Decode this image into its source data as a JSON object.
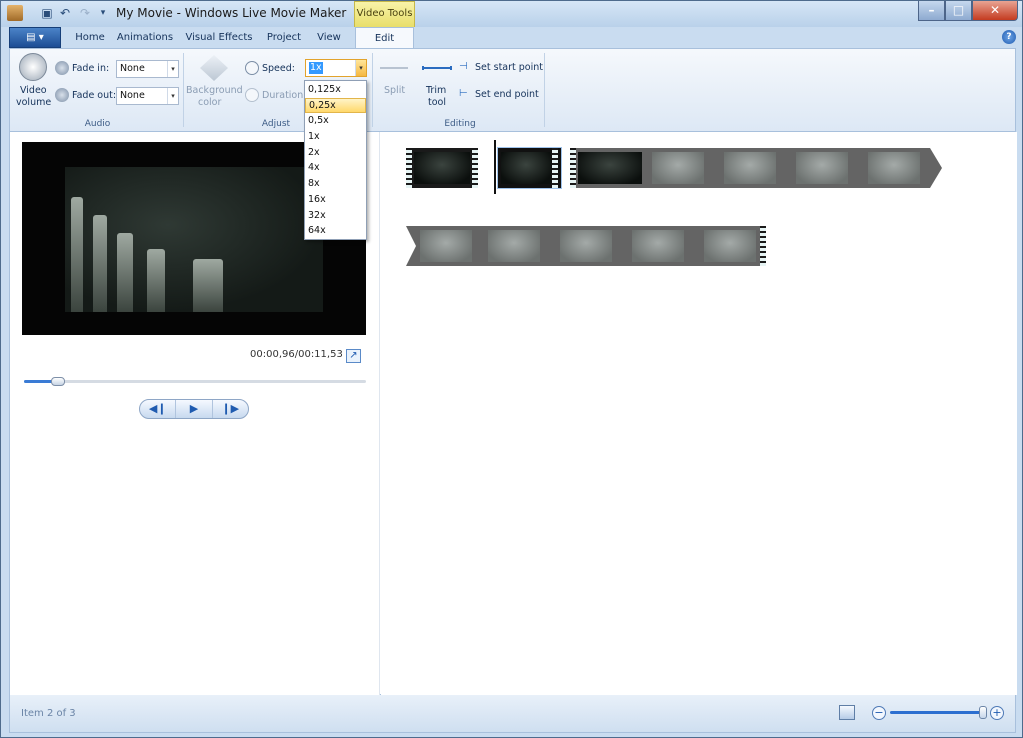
{
  "window": {
    "title": "My Movie - Windows Live Movie Maker",
    "context_tab_group": "Video Tools",
    "minimize": "–",
    "maximize": "□",
    "close": "✕"
  },
  "tabs": [
    {
      "label": "Home"
    },
    {
      "label": "Animations"
    },
    {
      "label": "Visual Effects"
    },
    {
      "label": "Project"
    },
    {
      "label": "View"
    },
    {
      "label": "Edit",
      "active": true
    }
  ],
  "ribbon": {
    "audio": {
      "group_label": "Audio",
      "video_volume_label_1": "Video",
      "video_volume_label_2": "volume",
      "fade_in_label": "Fade in:",
      "fade_in_value": "None",
      "fade_out_label": "Fade out:",
      "fade_out_value": "None"
    },
    "adjust": {
      "group_label": "Adjust",
      "background_color_label_1": "Background",
      "background_color_label_2": "color",
      "speed_label": "Speed:",
      "speed_value": "1x",
      "duration_label": "Duration:",
      "speed_options": [
        "0,125x",
        "0,25x",
        "0,5x",
        "1x",
        "2x",
        "4x",
        "8x",
        "16x",
        "32x",
        "64x"
      ],
      "speed_hovered": "0,25x"
    },
    "editing": {
      "group_label": "Editing",
      "split_label": "Split",
      "trim_tool_label_1": "Trim",
      "trim_tool_label_2": "tool",
      "set_start_point": "Set start point",
      "set_end_point": "Set end point"
    }
  },
  "preview": {
    "time_readout": "00:00,96/00:11,53",
    "seek_progress": 0.1,
    "transport": {
      "previous": "◀❙",
      "play": "▶",
      "next": "❙▶"
    }
  },
  "status": {
    "text": "Item 2 of 3",
    "zoom_level": 0.98
  },
  "colors": {
    "accent": "#1f5bb0",
    "context_tab": "#e8de6a",
    "selected_clip_outline": "#9fc3ec"
  }
}
